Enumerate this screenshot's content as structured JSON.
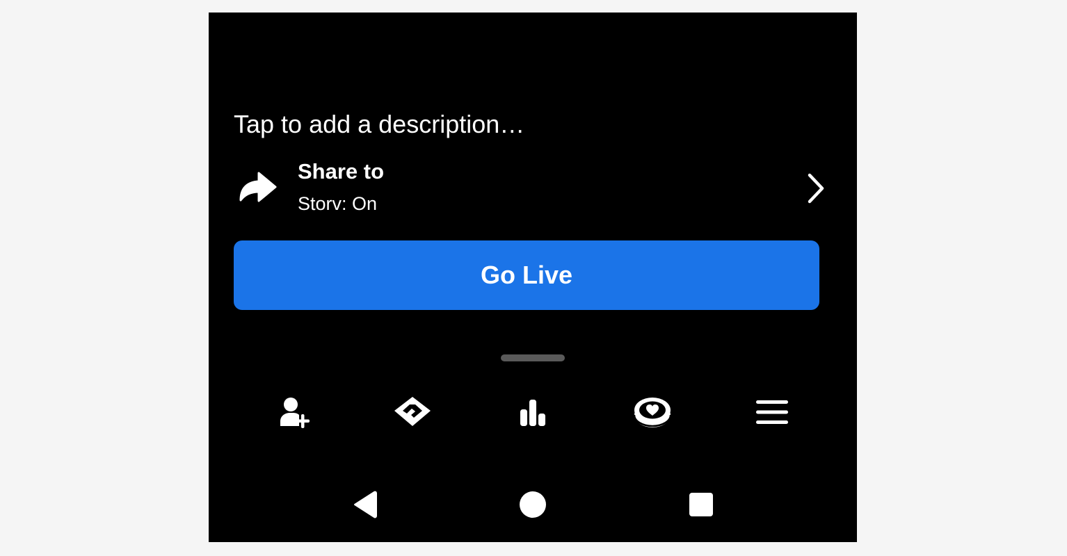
{
  "composer": {
    "description_placeholder": "Tap to add a description…"
  },
  "share": {
    "title": "Share to",
    "subtitle": "Storv: On",
    "icon": "share-arrow-icon",
    "chevron_icon": "chevron-right-icon"
  },
  "primary_action": {
    "label": "Go Live",
    "color": "#1b74e8"
  },
  "toolbar": {
    "items": [
      {
        "icon": "add-friend-icon"
      },
      {
        "icon": "handshake-icon"
      },
      {
        "icon": "poll-icon"
      },
      {
        "icon": "stars-icon"
      },
      {
        "icon": "menu-icon"
      }
    ]
  },
  "system_nav": {
    "items": [
      {
        "icon": "back-icon"
      },
      {
        "icon": "home-icon"
      },
      {
        "icon": "recents-icon"
      }
    ]
  },
  "colors": {
    "background": "#000000",
    "text": "#ffffff",
    "accent": "#1b74e8",
    "handle": "#5a5a5a"
  }
}
